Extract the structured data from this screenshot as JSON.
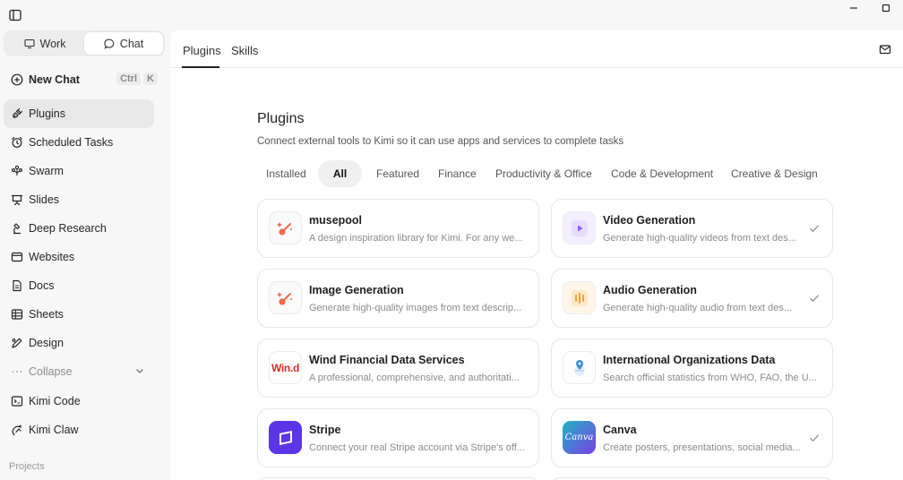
{
  "sidebar": {
    "mode_tabs": [
      {
        "label": "Work",
        "icon": "monitor-icon"
      },
      {
        "label": "Chat",
        "icon": "chat-bubble-icon"
      }
    ],
    "new_chat": {
      "label": "New Chat",
      "shortcut": [
        "Ctrl",
        "K"
      ],
      "icon": "plus-circle-icon"
    },
    "items": [
      {
        "label": "Plugins",
        "icon": "plug-icon"
      },
      {
        "label": "Scheduled Tasks",
        "icon": "alarm-clock-icon"
      },
      {
        "label": "Swarm",
        "icon": "swarm-icon"
      },
      {
        "label": "Slides",
        "icon": "presentation-icon"
      },
      {
        "label": "Deep Research",
        "icon": "research-icon"
      },
      {
        "label": "Websites",
        "icon": "browser-window-icon"
      },
      {
        "label": "Docs",
        "icon": "document-icon"
      },
      {
        "label": "Sheets",
        "icon": "table-icon"
      },
      {
        "label": "Design",
        "icon": "pen-nib-icon"
      }
    ],
    "collapse": {
      "label": "Collapse"
    },
    "extra_items": [
      {
        "label": "Kimi Code",
        "icon": "terminal-icon"
      },
      {
        "label": "Kimi Claw",
        "icon": "claw-icon"
      }
    ],
    "projects_label": "Projects"
  },
  "main": {
    "tabs": [
      {
        "label": "Plugins"
      },
      {
        "label": "Skills"
      }
    ],
    "title": "Plugins",
    "description": "Connect external tools to Kimi so it can use apps and services to complete tasks",
    "filters": [
      "Installed",
      "All",
      "Featured",
      "Finance",
      "Productivity & Office",
      "Code & Development",
      "Creative & Design"
    ],
    "plugins": [
      {
        "name": "musepool",
        "desc": "A design inspiration library for Kimi. For any we...",
        "installed": false,
        "logo": "magic-wand-icon"
      },
      {
        "name": "Video Generation",
        "desc": "Generate high-quality videos from text des...",
        "installed": true,
        "logo": "play-icon"
      },
      {
        "name": "Image Generation",
        "desc": "Generate high-quality images from text descrip...",
        "installed": false,
        "logo": "magic-wand-icon"
      },
      {
        "name": "Audio Generation",
        "desc": "Generate high-quality audio from text des...",
        "installed": true,
        "logo": "audio-bars-icon"
      },
      {
        "name": "Wind Financial Data Services",
        "desc": "A professional, comprehensive, and authoritati...",
        "installed": false,
        "logo_text": "Win.d"
      },
      {
        "name": "International Organizations Data",
        "desc": "Search official statistics from WHO, FAO, the U...",
        "installed": false,
        "logo": "globe-pin-icon"
      },
      {
        "name": "Stripe",
        "desc": "Connect your real Stripe account via Stripe's off...",
        "installed": false,
        "logo": "stripe-icon"
      },
      {
        "name": "Canva",
        "desc": "Create posters, presentations, social media...",
        "installed": true,
        "logo_text": "Canva"
      }
    ]
  },
  "colors": {
    "accent": "#222222",
    "wand": "#f0694f",
    "video": "#8b5cf6",
    "audio": "#f5a23a",
    "wind": "#d62a2a",
    "stripe": "#5b35e6",
    "canva_start": "#1fb3c4",
    "canva_end": "#7b3fe4"
  }
}
